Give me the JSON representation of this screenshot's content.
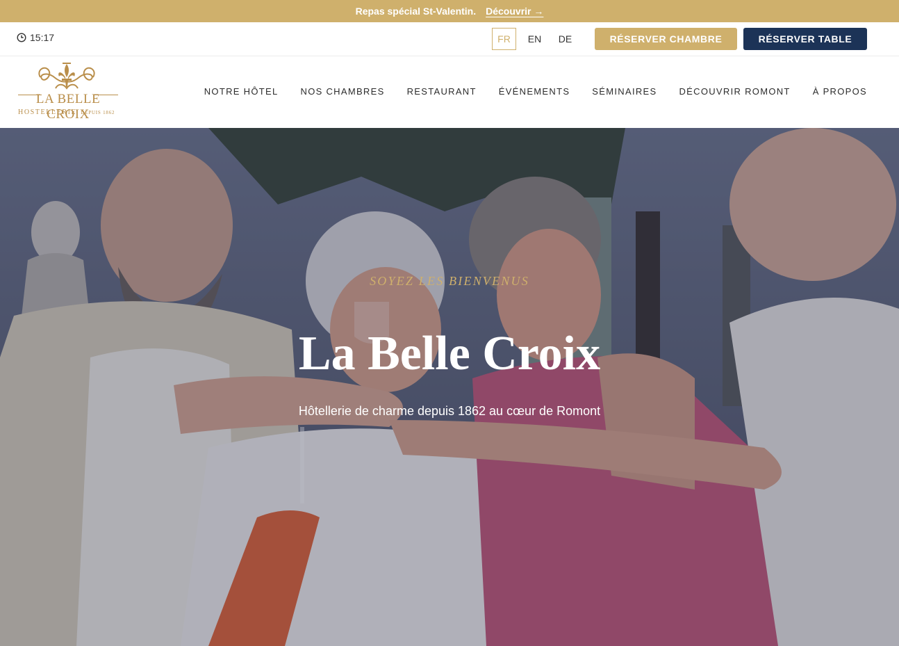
{
  "announcement": {
    "text": "Repas spécial St-Valentin.",
    "link": "Découvrir →"
  },
  "utility": {
    "time": "15:17",
    "languages": [
      "FR",
      "EN",
      "DE"
    ],
    "active_language": "FR",
    "book_room": "RÉSERVER CHAMBRE",
    "book_table": "RÉSERVER TABLE"
  },
  "logo": {
    "title": "LA BELLE CROIX",
    "subtitle": "HOSTELLERIE",
    "since": "DEPUIS 1862"
  },
  "nav": {
    "items": [
      "NOTRE HÔTEL",
      "NOS CHAMBRES",
      "RESTAURANT",
      "ÉVÉNEMENTS",
      "SÉMINAIRES",
      "DÉCOUVRIR ROMONT",
      "À PROPOS"
    ]
  },
  "hero": {
    "kicker": "SOYEZ LES BIENVENUS",
    "title": "La Belle Croix",
    "subtitle": "Hôtellerie de charme depuis 1862 au cœur de Romont"
  },
  "colors": {
    "gold": "#cfb06c",
    "navy": "#1c3357",
    "logo": "#b98e4a"
  }
}
